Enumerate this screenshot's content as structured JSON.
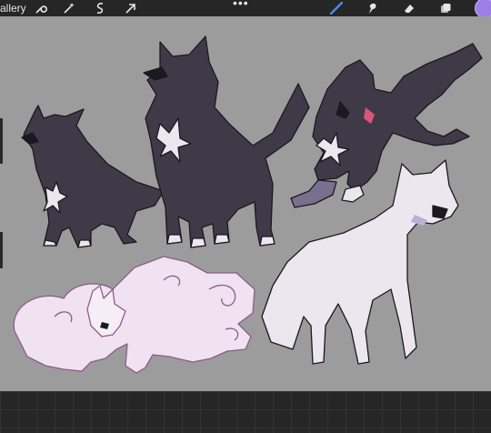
{
  "topbar": {
    "gallery_label": "allery",
    "more_label": "•••",
    "tools": {
      "left": [
        "wrench-icon",
        "magic-wand-icon",
        "selection-icon",
        "transform-arrow-icon"
      ],
      "right": [
        "brush-icon",
        "smudge-icon",
        "eraser-icon",
        "layers-icon"
      ]
    },
    "color": "#9b7fe6"
  },
  "canvas": {
    "background": "#9c9c9c",
    "subjects": [
      "black-wolf-small",
      "black-wolf-standing",
      "black-smoke-wolf",
      "white-wolf-standing",
      "pink-cloud-wolf"
    ]
  },
  "colors": {
    "black_wolf": "#3f3a48",
    "white_wolf": "#ece6ee",
    "pink_wolf": "#f0e2f0",
    "outline": "#1a1820"
  }
}
